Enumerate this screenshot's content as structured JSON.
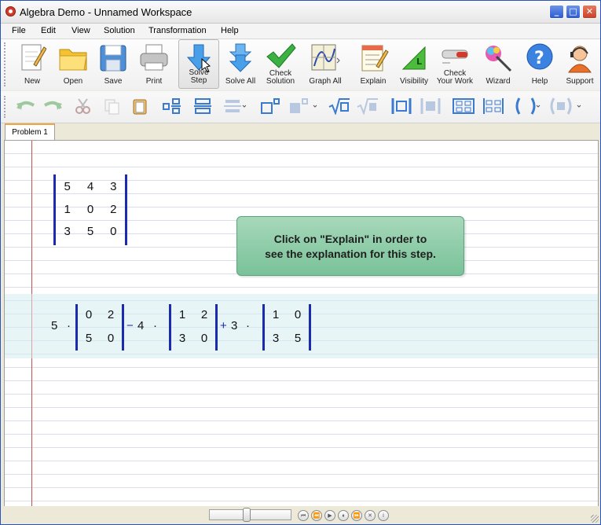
{
  "window": {
    "title": "Algebra Demo - Unnamed Workspace",
    "controls": {
      "minimize": "_",
      "maximize": "□",
      "close": "✕"
    }
  },
  "menu": [
    "File",
    "Edit",
    "View",
    "Solution",
    "Transformation",
    "Help"
  ],
  "toolbar": {
    "new": "New",
    "open": "Open",
    "save": "Save",
    "print": "Print",
    "solve_step": "Solve\nStep",
    "solve_all": "Solve All",
    "check_solution": "Check\nSolution",
    "graph_all": "Graph All",
    "explain": "Explain",
    "visibility": "Visibility",
    "check_your_work": "Check\nYour Work",
    "wizard": "Wizard",
    "help": "Help",
    "support": "Support",
    "visibility_letter": "L"
  },
  "format_toolbar": {
    "icons": [
      "undo-icon",
      "redo-icon",
      "cut-icon",
      "copy-icon",
      "paste-icon",
      "fraction-icon",
      "fraction-stack-icon",
      "fraction-line-icon",
      "superscript-icon",
      "subscript-icon",
      "sqrt-icon",
      "nth-root-icon",
      "abs-value-icon",
      "norm-icon",
      "matrix-icon",
      "matrix-alt-icon",
      "parentheses-icon",
      "bracket-icon"
    ]
  },
  "tabs": {
    "problem_1": "Problem 1"
  },
  "problem": {
    "matrix": [
      [
        "5",
        "4",
        "3"
      ],
      [
        "1",
        "0",
        "2"
      ],
      [
        "3",
        "5",
        "0"
      ]
    ],
    "expansion": {
      "coef1": "5",
      "dot1": "·",
      "m1": [
        [
          "0",
          "2"
        ],
        [
          "5",
          "0"
        ]
      ],
      "op2": "−",
      "coef2": "4",
      "dot2": "·",
      "m2": [
        [
          "1",
          "2"
        ],
        [
          "3",
          "0"
        ]
      ],
      "op3": "+",
      "coef3": "3",
      "dot3": "·",
      "m3": [
        [
          "1",
          "0"
        ],
        [
          "3",
          "5"
        ]
      ]
    }
  },
  "tooltip": {
    "line1": "Click on \"Explain\" in order to",
    "line2": "see the explanation for this step."
  },
  "player": {
    "first": "⏮",
    "prev": "⏪",
    "play": "▶",
    "pause": "⏸",
    "next": "⏩",
    "stop": "✕",
    "info": "i",
    "slider_position": 0.45
  },
  "colors": {
    "matrix_bar": "#1a2bb0",
    "margin_line": "#c9504f",
    "tooltip_bg": "#8ecca8",
    "tab_accent": "#f2a53a"
  }
}
